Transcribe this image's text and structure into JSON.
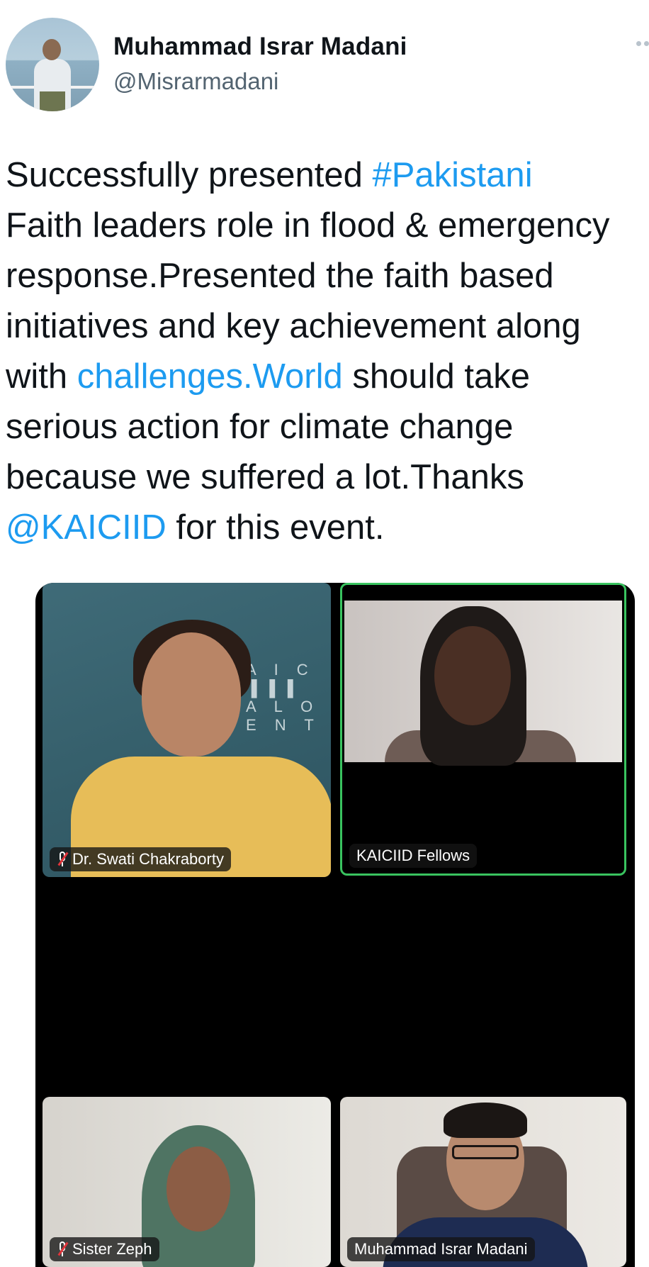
{
  "author": {
    "name": "Muhammad Israr Madani",
    "handle": "@Misrarmadani"
  },
  "tweet": {
    "text_1": "Successfully presented ",
    "hashtag": "#Pakistani",
    "text_2": "\nFaith leaders role in flood & emergency response.Presented the faith based initiatives and key achievement along with ",
    "link": "challenges.World",
    "text_3": " should take serious action for climate change because we suffered a lot.Thanks\n",
    "mention": "@KAICIID",
    "text_4": " for this event."
  },
  "media": {
    "participants": [
      {
        "label": "Dr. Swati Chakraborty",
        "muted": true
      },
      {
        "label": "KAICIID Fellows",
        "muted": false,
        "active_speaker": true
      },
      {
        "label": "Sister Zeph",
        "muted": true
      },
      {
        "label": "Muhammad Israr Madani",
        "muted": false
      }
    ]
  },
  "colors": {
    "link": "#1d9bf0",
    "active_speaker_border": "#39c35f",
    "muted_mic": "#e0343a"
  },
  "icons": [
    "more-options-icon",
    "mic-muted-icon"
  ]
}
